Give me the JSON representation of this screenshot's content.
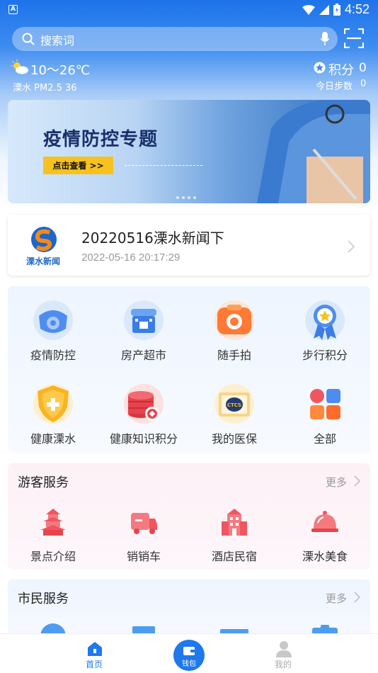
{
  "status_bar": {
    "app_badge": "A",
    "time": "4:52"
  },
  "search": {
    "placeholder": "搜索词"
  },
  "weather": {
    "temperature": "10～26℃",
    "aqi": "溧水 PM2.5  36"
  },
  "points": {
    "label": "积分",
    "value": "0"
  },
  "steps": {
    "label": "今日步数",
    "value": "0"
  },
  "banner": {
    "title": "疫情防控专题",
    "button": "点击查看 >>"
  },
  "news": {
    "logo_text": "溧水新闻",
    "title": "20220516溧水新闻下",
    "time": "2022-05-16 20:17:29"
  },
  "grid": [
    {
      "label": "疫情防控",
      "icon": "mask-virus-icon"
    },
    {
      "label": "房产超市",
      "icon": "store-icon"
    },
    {
      "label": "随手拍",
      "icon": "camera-icon"
    },
    {
      "label": "步行积分",
      "icon": "medal-icon"
    },
    {
      "label": "健康溧水",
      "icon": "health-shield-icon"
    },
    {
      "label": "健康知识积分",
      "icon": "coins-icon"
    },
    {
      "label": "我的医保",
      "icon": "insurance-card-icon"
    },
    {
      "label": "全部",
      "icon": "all-apps-icon"
    }
  ],
  "visitor_service": {
    "title": "游客服务",
    "more": "更多",
    "items": [
      {
        "label": "景点介绍",
        "icon": "pagoda-icon"
      },
      {
        "label": "销销车",
        "icon": "truck-icon"
      },
      {
        "label": "酒店民宿",
        "icon": "hotel-icon"
      },
      {
        "label": "溧水美食",
        "icon": "food-cloche-icon"
      }
    ]
  },
  "citizen_service": {
    "title": "市民服务",
    "more": "更多"
  },
  "bottom_nav": {
    "home": "首页",
    "wallet": "钱包",
    "mine": "我的"
  },
  "colors": {
    "primary": "#1f78ec",
    "accent_yellow": "#f7c21d",
    "service_red": "#f0565f"
  }
}
